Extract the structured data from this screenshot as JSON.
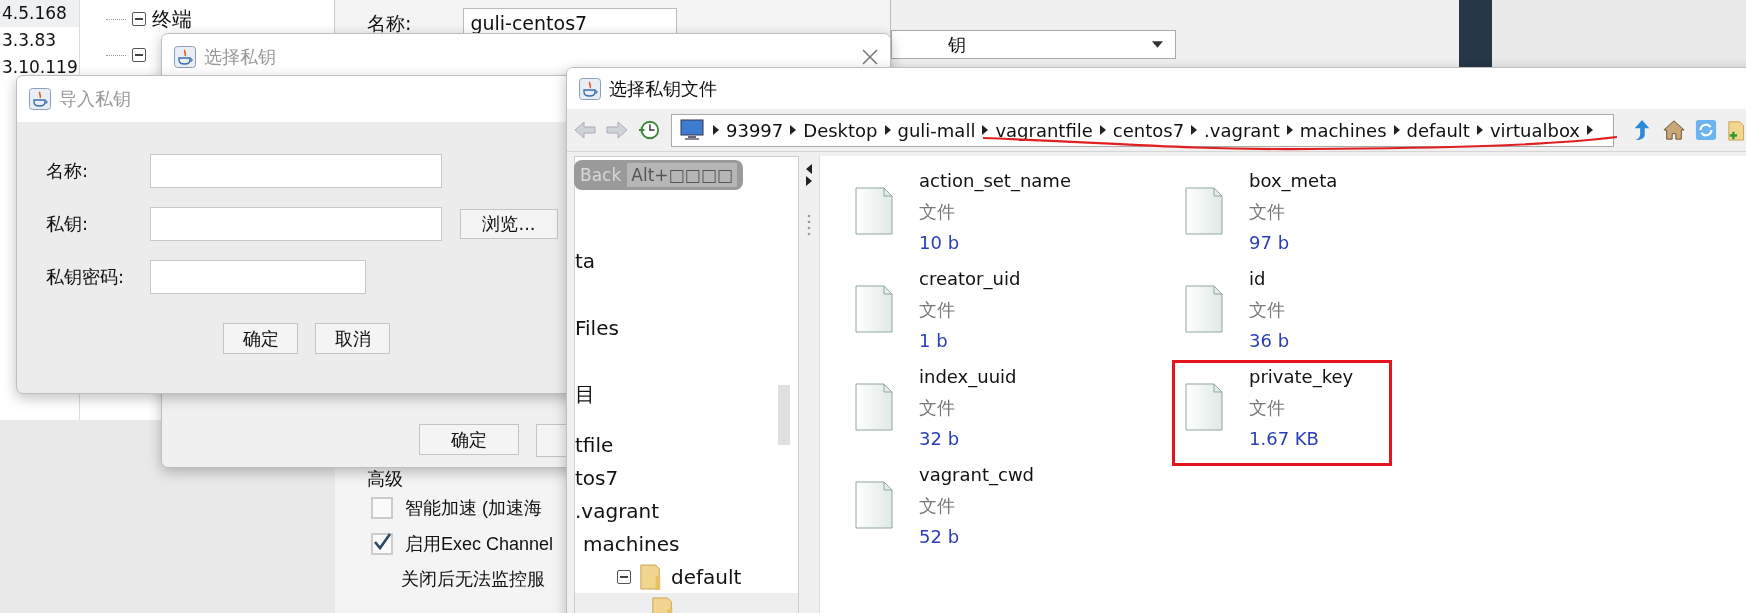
{
  "background_app": {
    "hosts": [
      "4.5.168",
      "3.3.83",
      "3.10.119"
    ],
    "tree": [
      {
        "label": "终端",
        "expanded": true
      },
      {
        "expanded": true
      }
    ],
    "name_label": "名称:",
    "name_value": "guli-centos7",
    "dropdown_value": "钥",
    "advanced_heading": "高级",
    "options": [
      {
        "label": "智能加速 (加速海",
        "checked": false
      },
      {
        "label": "启用Exec Channel",
        "checked": true
      }
    ],
    "note": "关闭后无法监控服"
  },
  "select_key_dialog": {
    "title": "选择私钥",
    "buttons": [
      "确定"
    ]
  },
  "import_dialog": {
    "title": "导入私钥",
    "fields": [
      {
        "label": "名称:"
      },
      {
        "label": "私钥:",
        "browse": "浏览..."
      },
      {
        "label": "私钥密码:"
      }
    ],
    "buttons": [
      "确定",
      "取消"
    ]
  },
  "file_chooser": {
    "title": "选择私钥文件",
    "path": [
      "93997",
      "Desktop",
      "guli-mall",
      "vagrantfile",
      "centos7",
      ".vagrant",
      "machines",
      "default",
      "virtualbox"
    ],
    "tooltip": {
      "label": "Back",
      "shortcut": "Alt+□□□□"
    },
    "tree": [
      {
        "label": "ta",
        "selected": false
      },
      {
        "label": "Files",
        "selected": false
      },
      {
        "label": "目",
        "selected": false
      },
      {
        "label": "tfile",
        "selected": false
      },
      {
        "label": "tos7",
        "selected": false
      },
      {
        "label": ".vagrant",
        "selected": false,
        "children": [
          {
            "label": "machines",
            "selected": false,
            "children": [
              {
                "label": "default",
                "selected": false,
                "expanded": true,
                "children": [
                  {
                    "selected": true
                  }
                ]
              }
            ]
          }
        ]
      }
    ],
    "files": [
      {
        "name": "action_set_name",
        "type": "文件",
        "size": "10 b",
        "marked": false
      },
      {
        "name": "box_meta",
        "type": "文件",
        "size": "97 b",
        "marked": false
      },
      {
        "name": "creator_uid",
        "type": "文件",
        "size": "1 b",
        "marked": false
      },
      {
        "name": "id",
        "type": "文件",
        "size": "36 b",
        "marked": false
      },
      {
        "name": "index_uuid",
        "type": "文件",
        "size": "32 b",
        "marked": false
      },
      {
        "name": "private_key",
        "type": "文件",
        "size": "1.67 KB",
        "marked": true
      },
      {
        "name": "vagrant_cwd",
        "type": "文件",
        "size": "52 b",
        "marked": false
      }
    ]
  }
}
